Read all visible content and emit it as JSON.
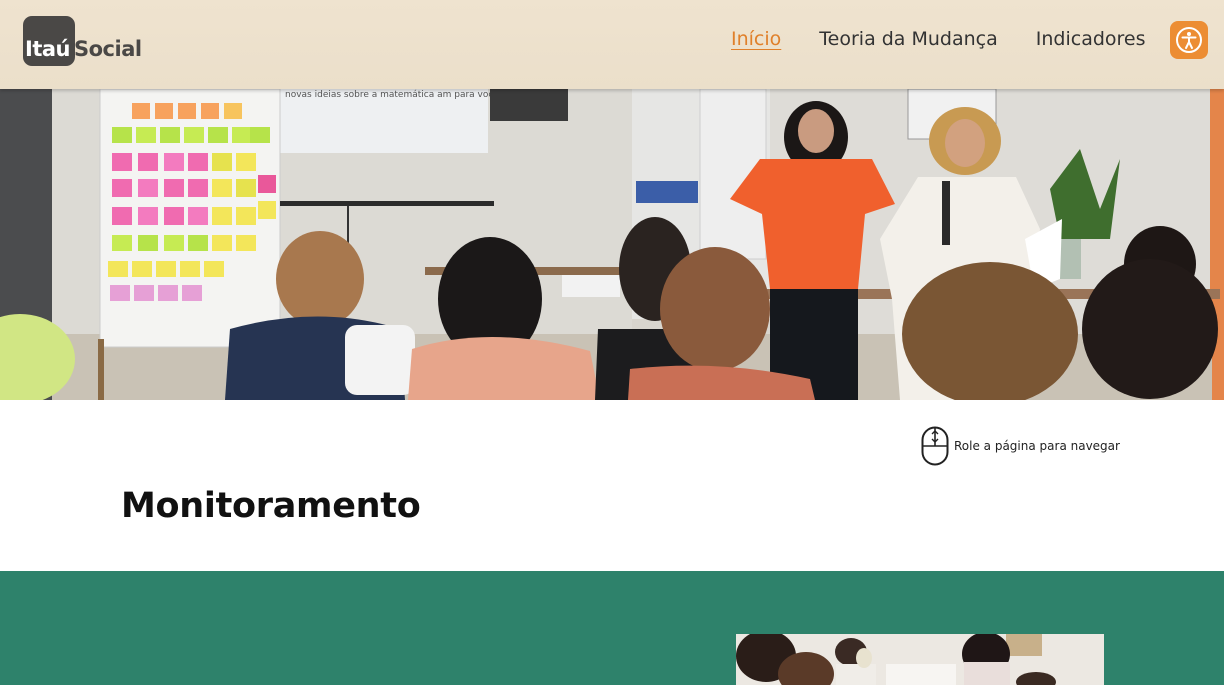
{
  "header": {
    "logo_brand": "Itaú",
    "logo_rest": "Social",
    "nav": [
      {
        "label": "Início",
        "active": true
      },
      {
        "label": "Teoria da Mudança",
        "active": false
      },
      {
        "label": "Indicadores",
        "active": false
      }
    ],
    "accessibility_icon": "accessibility-person-icon"
  },
  "hero": {
    "image": "photo-workshop-presentation",
    "screen_text": "novas ideias sobre a matemática am para você?"
  },
  "scroll_hint": {
    "icon": "mouse-scroll-icon",
    "label": "Role a página para navegar"
  },
  "main": {
    "title": "Monitoramento"
  },
  "colors": {
    "header_bg": "#efe3cf",
    "accent": "#e0802a",
    "accessibility_btn": "#ec8d33",
    "section_green": "#2e826b",
    "logo_dark": "#4a4846"
  },
  "green_section": {
    "image": "photo-classroom-activity"
  }
}
